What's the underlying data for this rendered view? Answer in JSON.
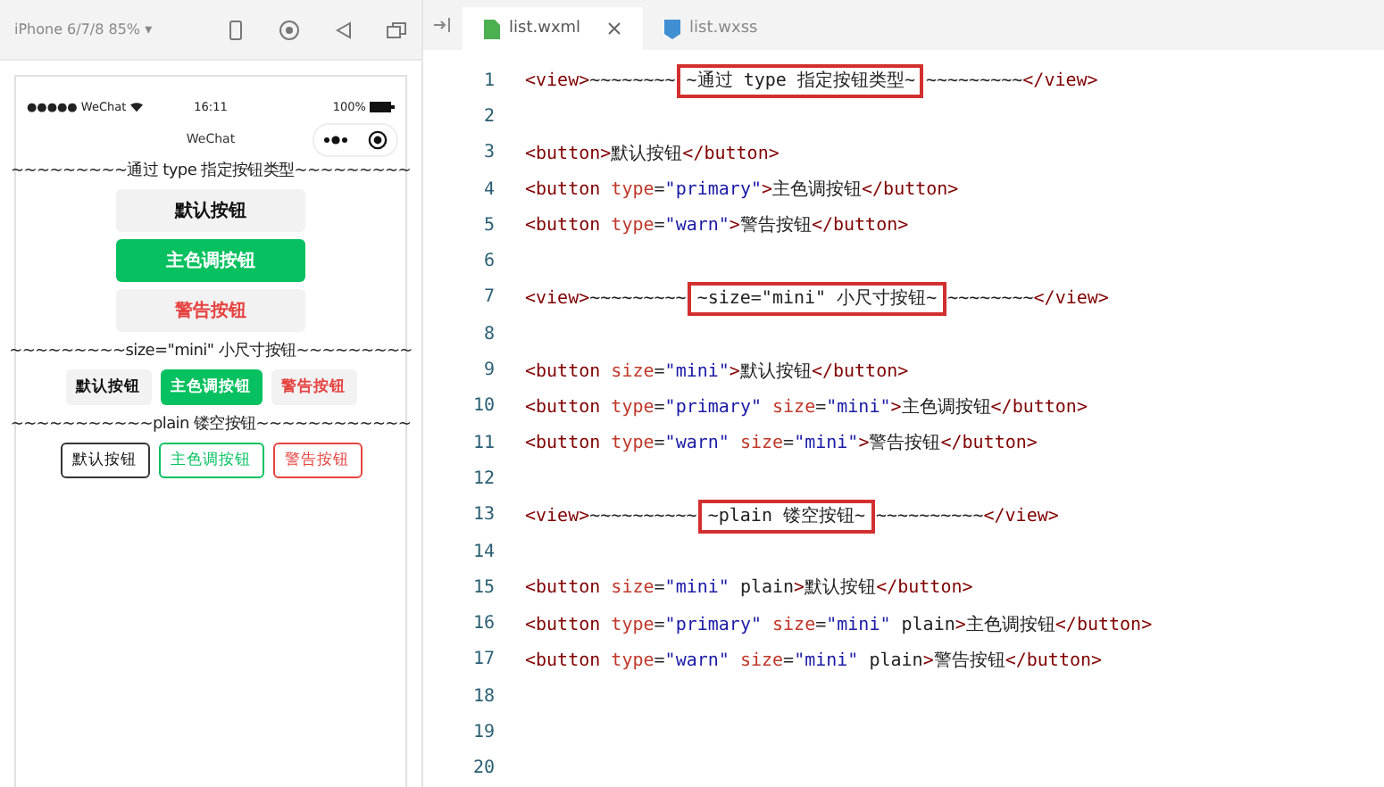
{
  "simulator": {
    "device": "iPhone 6/7/8 85% ▾"
  },
  "phone": {
    "carrier": "●●●●● WeChat",
    "time": "16:11",
    "battery": "100%",
    "nav_title": "WeChat",
    "content": [
      {
        "kind": "divider",
        "text": "~~~~~~~~~通过 type 指定按钮类型~~~~~~~~~"
      },
      {
        "kind": "full_buttons",
        "buttons": [
          {
            "label": "默认按钮",
            "kind": "default",
            "plain": false
          },
          {
            "label": "主色调按钮",
            "kind": "primary",
            "plain": false
          },
          {
            "label": "警告按钮",
            "kind": "warn",
            "plain": false
          }
        ]
      },
      {
        "kind": "divider",
        "text": "~~~~~~~~~size=\"mini\" 小尺寸按钮~~~~~~~~~"
      },
      {
        "kind": "mini_buttons",
        "buttons": [
          {
            "label": "默认按钮",
            "kind": "default",
            "plain": false
          },
          {
            "label": "主色调按钮",
            "kind": "primary",
            "plain": false
          },
          {
            "label": "警告按钮",
            "kind": "warn",
            "plain": false
          }
        ]
      },
      {
        "kind": "divider",
        "text": "~~~~~~~~~~~plain 镂空按钮~~~~~~~~~~~~"
      },
      {
        "kind": "mini_buttons",
        "buttons": [
          {
            "label": "默认按钮",
            "kind": "default",
            "plain": true
          },
          {
            "label": "主色调按钮",
            "kind": "primary",
            "plain": true
          },
          {
            "label": "警告按钮",
            "kind": "warn",
            "plain": true
          }
        ]
      }
    ]
  },
  "editor": {
    "tabs": [
      {
        "label": "list.wxml",
        "selected": true,
        "kind": "wxml"
      },
      {
        "label": "list.wxss",
        "selected": false,
        "kind": "wxss"
      }
    ],
    "lines": [
      {
        "number": "1",
        "tokens": [
          {
            "kind": "tag",
            "text": "<view>"
          },
          {
            "kind": "text",
            "text": "~~~~~~~~"
          },
          {
            "kind": "hl",
            "text": "~通过 type 指定按钮类型~"
          },
          {
            "kind": "text",
            "text": "~~~~~~~~~"
          },
          {
            "kind": "tag",
            "text": "</view>"
          }
        ]
      },
      {
        "number": "2"
      },
      {
        "number": "3",
        "tokens": [
          {
            "kind": "tag",
            "text": "<button>"
          },
          {
            "kind": "text",
            "text": "默认按钮"
          },
          {
            "kind": "tag",
            "text": "</button>"
          }
        ]
      },
      {
        "number": "4",
        "tokens": [
          {
            "kind": "tag",
            "text": "<button"
          },
          {
            "kind": "attr",
            "text": " type"
          },
          {
            "kind": "text",
            "text": "="
          },
          {
            "kind": "str",
            "text": "\"primary\""
          },
          {
            "kind": "tag",
            "text": ">"
          },
          {
            "kind": "text",
            "text": "主色调按钮"
          },
          {
            "kind": "tag",
            "text": "</button>"
          }
        ]
      },
      {
        "number": "5",
        "tokens": [
          {
            "kind": "tag",
            "text": "<button"
          },
          {
            "kind": "attr",
            "text": " type"
          },
          {
            "kind": "text",
            "text": "="
          },
          {
            "kind": "str",
            "text": "\"warn\""
          },
          {
            "kind": "tag",
            "text": ">"
          },
          {
            "kind": "text",
            "text": "警告按钮"
          },
          {
            "kind": "tag",
            "text": "</button>"
          }
        ]
      },
      {
        "number": "6"
      },
      {
        "number": "7",
        "tokens": [
          {
            "kind": "tag",
            "text": "<view>"
          },
          {
            "kind": "text",
            "text": "~~~~~~~~~"
          },
          {
            "kind": "hl",
            "text": "~size=\"mini\" 小尺寸按钮~"
          },
          {
            "kind": "text",
            "text": "~~~~~~~~"
          },
          {
            "kind": "tag",
            "text": "</view>"
          }
        ]
      },
      {
        "number": "8"
      },
      {
        "number": "9",
        "tokens": [
          {
            "kind": "tag",
            "text": "<button"
          },
          {
            "kind": "attr",
            "text": " size"
          },
          {
            "kind": "text",
            "text": "="
          },
          {
            "kind": "str",
            "text": "\"mini\""
          },
          {
            "kind": "tag",
            "text": ">"
          },
          {
            "kind": "text",
            "text": "默认按钮"
          },
          {
            "kind": "tag",
            "text": "</button>"
          }
        ]
      },
      {
        "number": "10",
        "tokens": [
          {
            "kind": "tag",
            "text": "<button"
          },
          {
            "kind": "attr",
            "text": " type"
          },
          {
            "kind": "text",
            "text": "="
          },
          {
            "kind": "str",
            "text": "\"primary\""
          },
          {
            "kind": "attr",
            "text": " size"
          },
          {
            "kind": "text",
            "text": "="
          },
          {
            "kind": "str",
            "text": "\"mini\""
          },
          {
            "kind": "tag",
            "text": ">"
          },
          {
            "kind": "text",
            "text": "主色调按钮"
          },
          {
            "kind": "tag",
            "text": "</button>"
          }
        ]
      },
      {
        "number": "11",
        "tokens": [
          {
            "kind": "tag",
            "text": "<button"
          },
          {
            "kind": "attr",
            "text": " type"
          },
          {
            "kind": "text",
            "text": "="
          },
          {
            "kind": "str",
            "text": "\"warn\""
          },
          {
            "kind": "attr",
            "text": " size"
          },
          {
            "kind": "text",
            "text": "="
          },
          {
            "kind": "str",
            "text": "\"mini\""
          },
          {
            "kind": "tag",
            "text": ">"
          },
          {
            "kind": "text",
            "text": "警告按钮"
          },
          {
            "kind": "tag",
            "text": "</button>"
          }
        ]
      },
      {
        "number": "12"
      },
      {
        "number": "13",
        "tokens": [
          {
            "kind": "tag",
            "text": "<view>"
          },
          {
            "kind": "text",
            "text": "~~~~~~~~~~"
          },
          {
            "kind": "hl",
            "text": "~plain 镂空按钮~"
          },
          {
            "kind": "text",
            "text": "~~~~~~~~~~"
          },
          {
            "kind": "tag",
            "text": "</view>"
          }
        ]
      },
      {
        "number": "14"
      },
      {
        "number": "15",
        "tokens": [
          {
            "kind": "tag",
            "text": "<button"
          },
          {
            "kind": "attr",
            "text": " size"
          },
          {
            "kind": "text",
            "text": "="
          },
          {
            "kind": "str",
            "text": "\"mini\""
          },
          {
            "kind": "text",
            "text": " plain"
          },
          {
            "kind": "tag",
            "text": ">"
          },
          {
            "kind": "text",
            "text": "默认按钮"
          },
          {
            "kind": "tag",
            "text": "</button>"
          }
        ]
      },
      {
        "number": "16",
        "tokens": [
          {
            "kind": "tag",
            "text": "<button"
          },
          {
            "kind": "attr",
            "text": " type"
          },
          {
            "kind": "text",
            "text": "="
          },
          {
            "kind": "str",
            "text": "\"primary\""
          },
          {
            "kind": "attr",
            "text": " size"
          },
          {
            "kind": "text",
            "text": "="
          },
          {
            "kind": "str",
            "text": "\"mini\""
          },
          {
            "kind": "text",
            "text": " plain"
          },
          {
            "kind": "tag",
            "text": ">"
          },
          {
            "kind": "text",
            "text": "主色调按钮"
          },
          {
            "kind": "tag",
            "text": "</button>"
          }
        ]
      },
      {
        "number": "17",
        "tokens": [
          {
            "kind": "tag",
            "text": "<button"
          },
          {
            "kind": "attr",
            "text": " type"
          },
          {
            "kind": "text",
            "text": "="
          },
          {
            "kind": "str",
            "text": "\"warn\""
          },
          {
            "kind": "attr",
            "text": " size"
          },
          {
            "kind": "text",
            "text": "="
          },
          {
            "kind": "str",
            "text": "\"mini\""
          },
          {
            "kind": "text",
            "text": " plain"
          },
          {
            "kind": "tag",
            "text": ">"
          },
          {
            "kind": "text",
            "text": "警告按钮"
          },
          {
            "kind": "tag",
            "text": "</button>"
          }
        ]
      },
      {
        "number": "18"
      },
      {
        "number": "19"
      },
      {
        "number": "20"
      }
    ]
  }
}
